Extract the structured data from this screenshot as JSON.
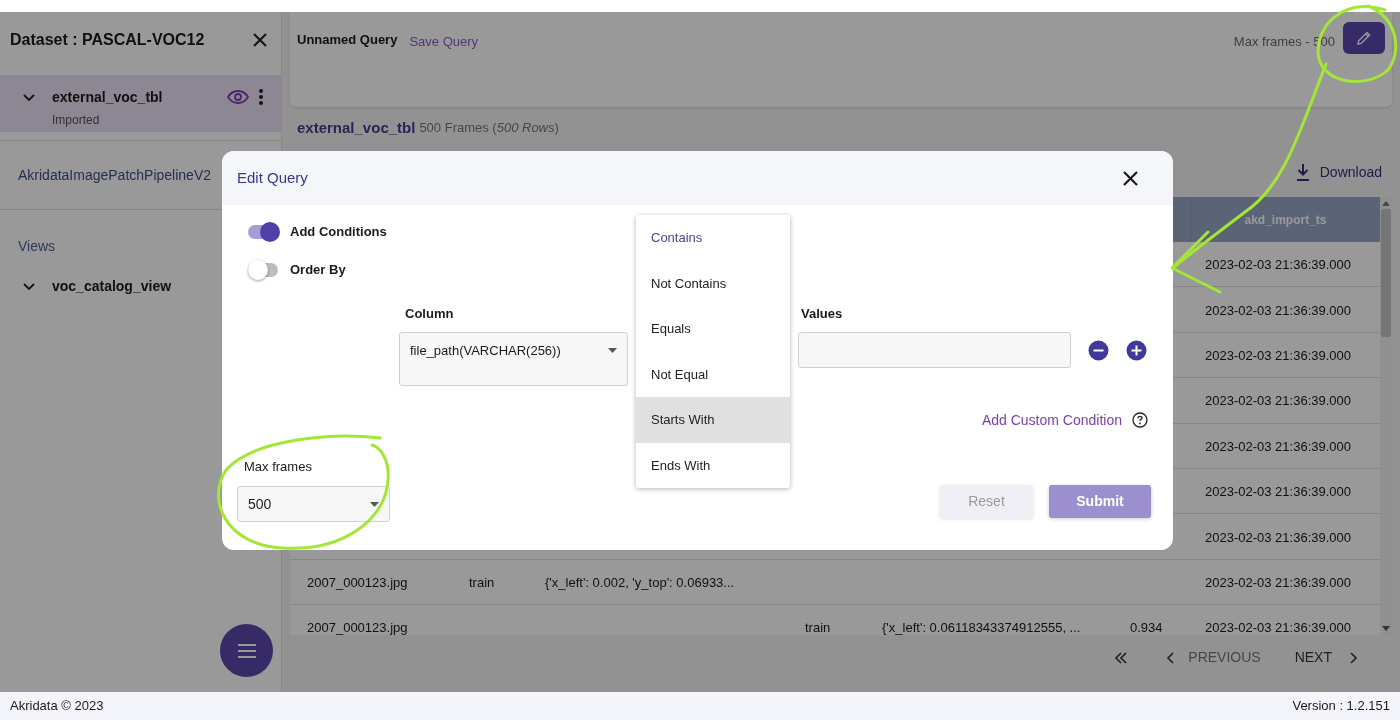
{
  "sidebar": {
    "title": "Dataset : PASCAL-VOC12",
    "datasets": [
      {
        "name": "external_voc_tbl",
        "subtitle": "Imported",
        "expanded": true,
        "selected": true
      }
    ],
    "pipeline": "AkridataImagePatchPipelineV2",
    "views_heading": "Views",
    "views": [
      {
        "name": "voc_catalog_view",
        "expanded": true,
        "selected": false
      }
    ]
  },
  "query_bar": {
    "title": "Unnamed Query",
    "save_link": "Save Query",
    "max_frames": "Max frames - 500"
  },
  "table_title": {
    "name": "external_voc_tbl",
    "summary": "500 Frames (*500 Rows*)"
  },
  "download": "Download",
  "table": {
    "header": {
      "column_7": "akd_import_ts"
    },
    "rows": [
      {
        "column_7": "2023-02-03 21:36:39.000"
      },
      {
        "column_7": "2023-02-03 21:36:39.000"
      },
      {
        "column_7": "2023-02-03 21:36:39.000"
      },
      {
        "column_7": "2023-02-03 21:36:39.000"
      },
      {
        "column_7": "2023-02-03 21:36:39.000"
      },
      {
        "column_7": "2023-02-03 21:36:39.000"
      },
      {
        "column_7": "2023-02-03 21:36:39.000"
      },
      {
        "column_1": "2007_000123.jpg",
        "column_2": "train",
        "column_3": "{'x_left': 0.002, 'y_top': 0.06933...",
        "column_7": "2023-02-03 21:36:39.000"
      },
      {
        "column_1": "2007_000123.jpg",
        "column_4": "train",
        "column_5": "{'x_left': 0.06118343374912555, ...",
        "column_6": "0.934",
        "column_7": "2023-02-03 21:36:39.000"
      }
    ]
  },
  "pagination": {
    "previous": "PREVIOUS",
    "next": "NEXT"
  },
  "footer": {
    "copyright": "Akridata © 2023",
    "version": "Version : 1.2.151"
  },
  "dialog": {
    "title": "Edit Query",
    "toggles": [
      {
        "label": "Add Conditions",
        "on": true
      },
      {
        "label": "Order By",
        "on": false
      }
    ],
    "column": {
      "label": "Column",
      "value": "file_path(VARCHAR(256))"
    },
    "operator_menu": [
      {
        "label": "Contains",
        "selected": true,
        "highlighted": false
      },
      {
        "label": "Not Contains",
        "selected": false,
        "highlighted": false
      },
      {
        "label": "Equals",
        "selected": false,
        "highlighted": false
      },
      {
        "label": "Not Equal",
        "selected": false,
        "highlighted": false
      },
      {
        "label": "Starts With",
        "selected": false,
        "highlighted": true
      },
      {
        "label": "Ends With",
        "selected": false,
        "highlighted": false
      }
    ],
    "values": {
      "label": "Values"
    },
    "custom_condition": "Add Custom Condition",
    "max_frames": {
      "label": "Max frames",
      "value": "500"
    },
    "buttons": [
      {
        "label": "Reset",
        "kind": "secondary"
      },
      {
        "label": "Submit",
        "kind": "primary"
      }
    ]
  }
}
